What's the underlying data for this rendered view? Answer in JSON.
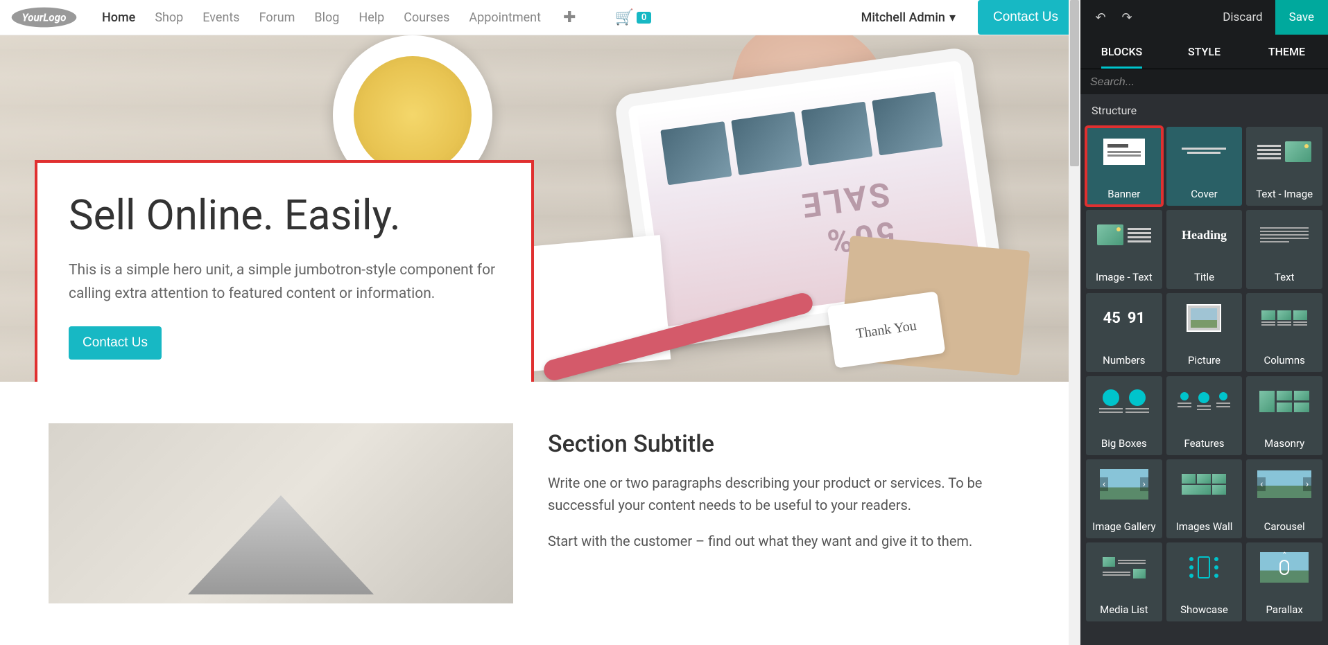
{
  "nav": {
    "items": [
      "Home",
      "Shop",
      "Events",
      "Forum",
      "Blog",
      "Help",
      "Courses",
      "Appointment"
    ],
    "active_index": 0
  },
  "cart": {
    "count": "0"
  },
  "user": {
    "name": "Mitchell Admin"
  },
  "contact_button": "Contact Us",
  "hero": {
    "title": "Sell Online. Easily.",
    "subtitle": "This is a simple hero unit, a simple jumbotron-style component for calling extra attention to featured content or information.",
    "button": "Contact Us",
    "tag_text": "Thank You",
    "sale_text": "50% SALE"
  },
  "section": {
    "title": "Section Subtitle",
    "para1": "Write one or two paragraphs describing your product or services. To be successful your content needs to be useful to your readers.",
    "para2": "Start with the customer – find out what they want and give it to them."
  },
  "sidebar": {
    "discard": "Discard",
    "save": "Save",
    "tabs": [
      "BLOCKS",
      "STYLE",
      "THEME"
    ],
    "active_tab": 0,
    "search_placeholder": "Search...",
    "section_title": "Structure",
    "blocks": [
      {
        "label": "Banner",
        "highlighted": true,
        "teal": true
      },
      {
        "label": "Cover",
        "teal": true
      },
      {
        "label": "Text - Image"
      },
      {
        "label": "Image - Text"
      },
      {
        "label": "Title"
      },
      {
        "label": "Text"
      },
      {
        "label": "Numbers"
      },
      {
        "label": "Picture"
      },
      {
        "label": "Columns"
      },
      {
        "label": "Big Boxes"
      },
      {
        "label": "Features"
      },
      {
        "label": "Masonry"
      },
      {
        "label": "Image Gallery"
      },
      {
        "label": "Images Wall"
      },
      {
        "label": "Carousel"
      },
      {
        "label": "Media List"
      },
      {
        "label": "Showcase"
      },
      {
        "label": "Parallax"
      }
    ],
    "numbers_preview": [
      "45",
      "91"
    ],
    "heading_preview": "Heading"
  }
}
